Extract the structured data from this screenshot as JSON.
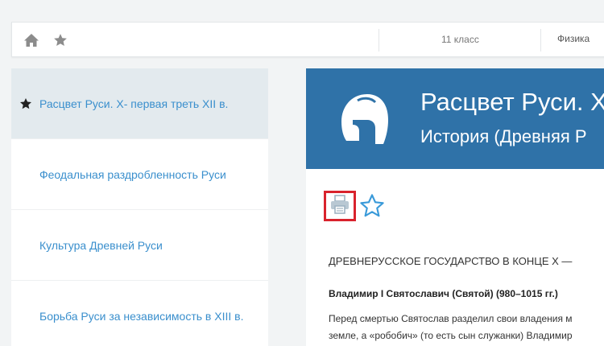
{
  "topbar": {
    "home_icon": "home-icon",
    "favorites_icon": "star-icon",
    "grade": "11 класс",
    "subject": "Физика"
  },
  "sidebar": {
    "items": [
      {
        "label": "Расцвет Руси. X- первая треть XII в.",
        "active": true
      },
      {
        "label": "Феодальная раздробленность Руси",
        "active": false
      },
      {
        "label": "Культура Древней Руси",
        "active": false
      },
      {
        "label": "Борьба Руси за независимость в XIII в.",
        "active": false
      }
    ]
  },
  "banner": {
    "title": "Расцвет Руси. X",
    "subtitle": "История (Древняя Р",
    "icon": "spartan-helmet-icon",
    "color": "#2f72a8"
  },
  "tools": {
    "print_icon": "printer-icon",
    "favorite_icon": "star-outline-icon",
    "highlight_color": "#d9232d"
  },
  "content": {
    "heading": "ДРЕВНЕРУССКОЕ ГОСУДАРСТВО В КОНЦЕ X —",
    "subheading": "Владимир I Святославич (Святой) (980–1015 гг.)",
    "paragraph_lines": [
      "Перед смертью Святослав разделил свои владения м",
      "земле, а «робобич» (то есть сын служанки) Владимир"
    ]
  }
}
